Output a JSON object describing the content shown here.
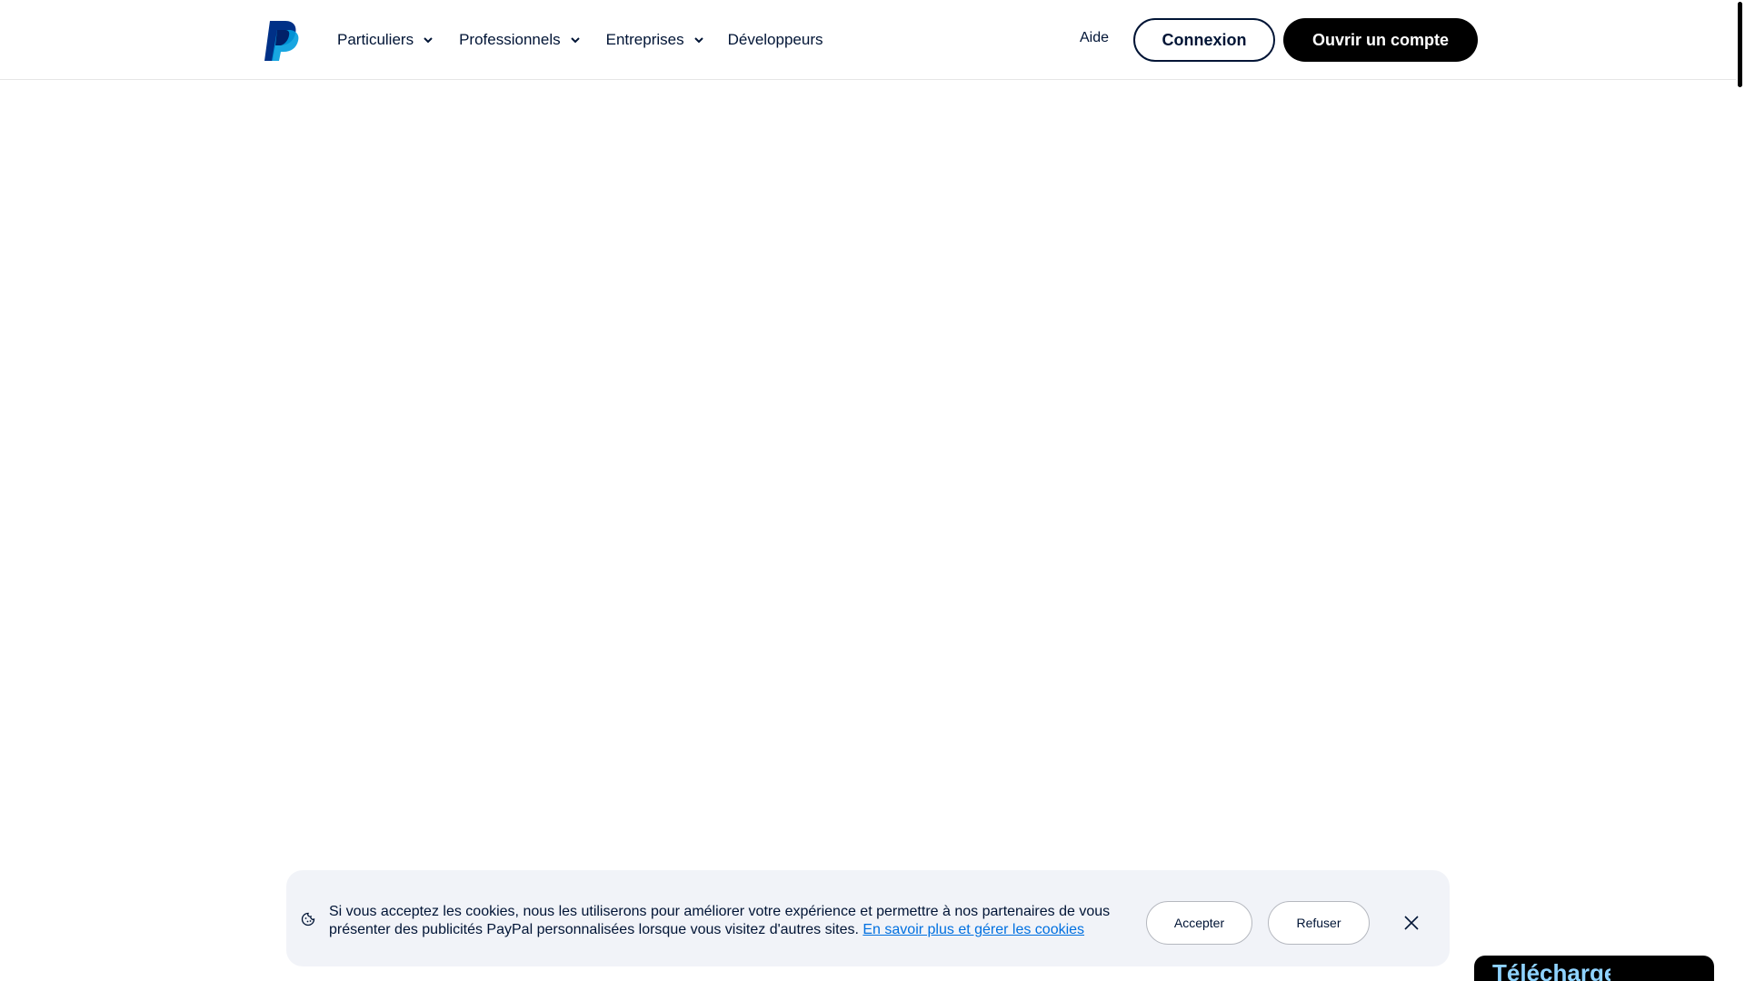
{
  "header": {
    "logo": "paypal-logo",
    "nav": [
      {
        "label": "Particuliers",
        "has_dropdown": true
      },
      {
        "label": "Professionnels",
        "has_dropdown": true
      },
      {
        "label": "Entreprises",
        "has_dropdown": true
      },
      {
        "label": "Développeurs",
        "has_dropdown": false
      }
    ],
    "help_label": "Aide",
    "login_label": "Connexion",
    "signup_label": "Ouvrir un compte"
  },
  "cookie_banner": {
    "icon": "cookie-icon",
    "text": "Si vous acceptez les cookies, nous les utiliserons pour améliorer votre expérience et permettre à nos partenaires de vous présenter des publicités PayPal personnalisées lorsque vous visitez d'autres sites.",
    "link_label": "En savoir plus et gérer les cookies",
    "accept_label": "Accepter",
    "refuse_label": "Refuser",
    "close_icon": "close-icon"
  },
  "promo": {
    "label": "Télécharger"
  },
  "colors": {
    "text": "#001435",
    "link": "#0070e0",
    "banner_bg": "#f1f3f8",
    "promo_text": "#8fd3ff",
    "logo_dark": "#003087",
    "logo_light": "#009cde"
  }
}
